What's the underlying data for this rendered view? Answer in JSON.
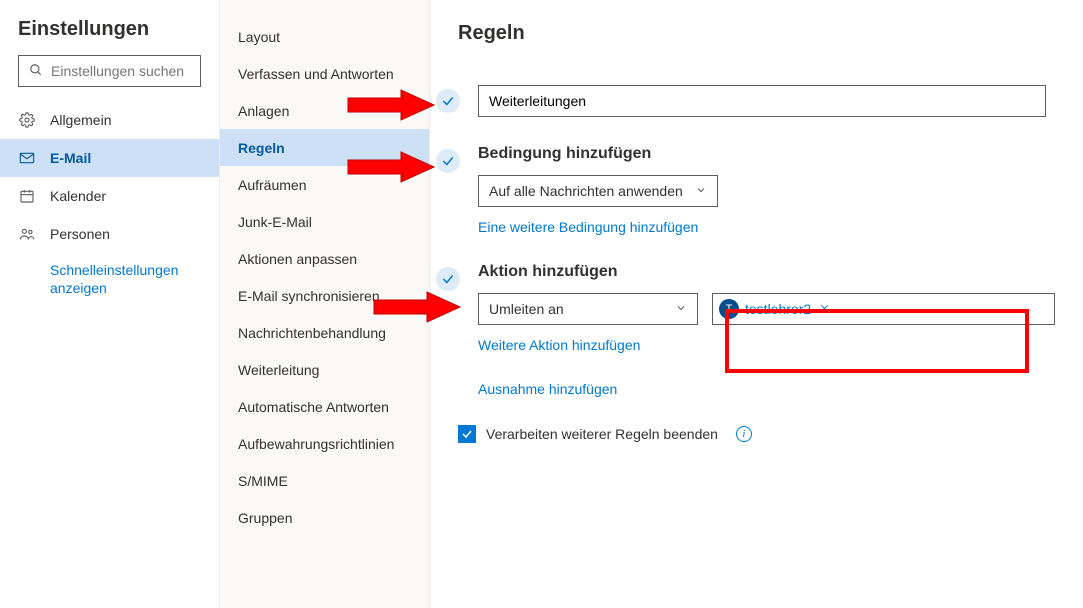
{
  "sidebar": {
    "title": "Einstellungen",
    "search_placeholder": "Einstellungen suchen",
    "items": [
      {
        "id": "general",
        "label": "Allgemein"
      },
      {
        "id": "mail",
        "label": "E-Mail"
      },
      {
        "id": "calendar",
        "label": "Kalender"
      },
      {
        "id": "people",
        "label": "Personen"
      }
    ],
    "quick_link": "Schnelleinstellungen anzeigen"
  },
  "subnav": {
    "items": [
      "Layout",
      "Verfassen und Antworten",
      "Anlagen",
      "Regeln",
      "Aufräumen",
      "Junk-E-Mail",
      "Aktionen anpassen",
      "E-Mail synchronisieren",
      "Nachrichtenbehandlung",
      "Weiterleitung",
      "Automatische Antworten",
      "Aufbewahrungsrichtlinien",
      "S/MIME",
      "Gruppen"
    ],
    "active_index": 3
  },
  "main": {
    "heading": "Regeln",
    "rule_name": "Weiterleitungen",
    "condition": {
      "title": "Bedingung hinzufügen",
      "selected": "Auf alle Nachrichten anwenden",
      "add_link": "Eine weitere Bedingung hinzufügen"
    },
    "action": {
      "title": "Aktion hinzufügen",
      "selected": "Umleiten an",
      "recipient": {
        "initial": "T",
        "name": "testlehrer2"
      },
      "add_link": "Weitere Aktion hinzufügen"
    },
    "exception_link": "Ausnahme hinzufügen",
    "stop_processing": "Verarbeiten weiterer Regeln beenden"
  }
}
